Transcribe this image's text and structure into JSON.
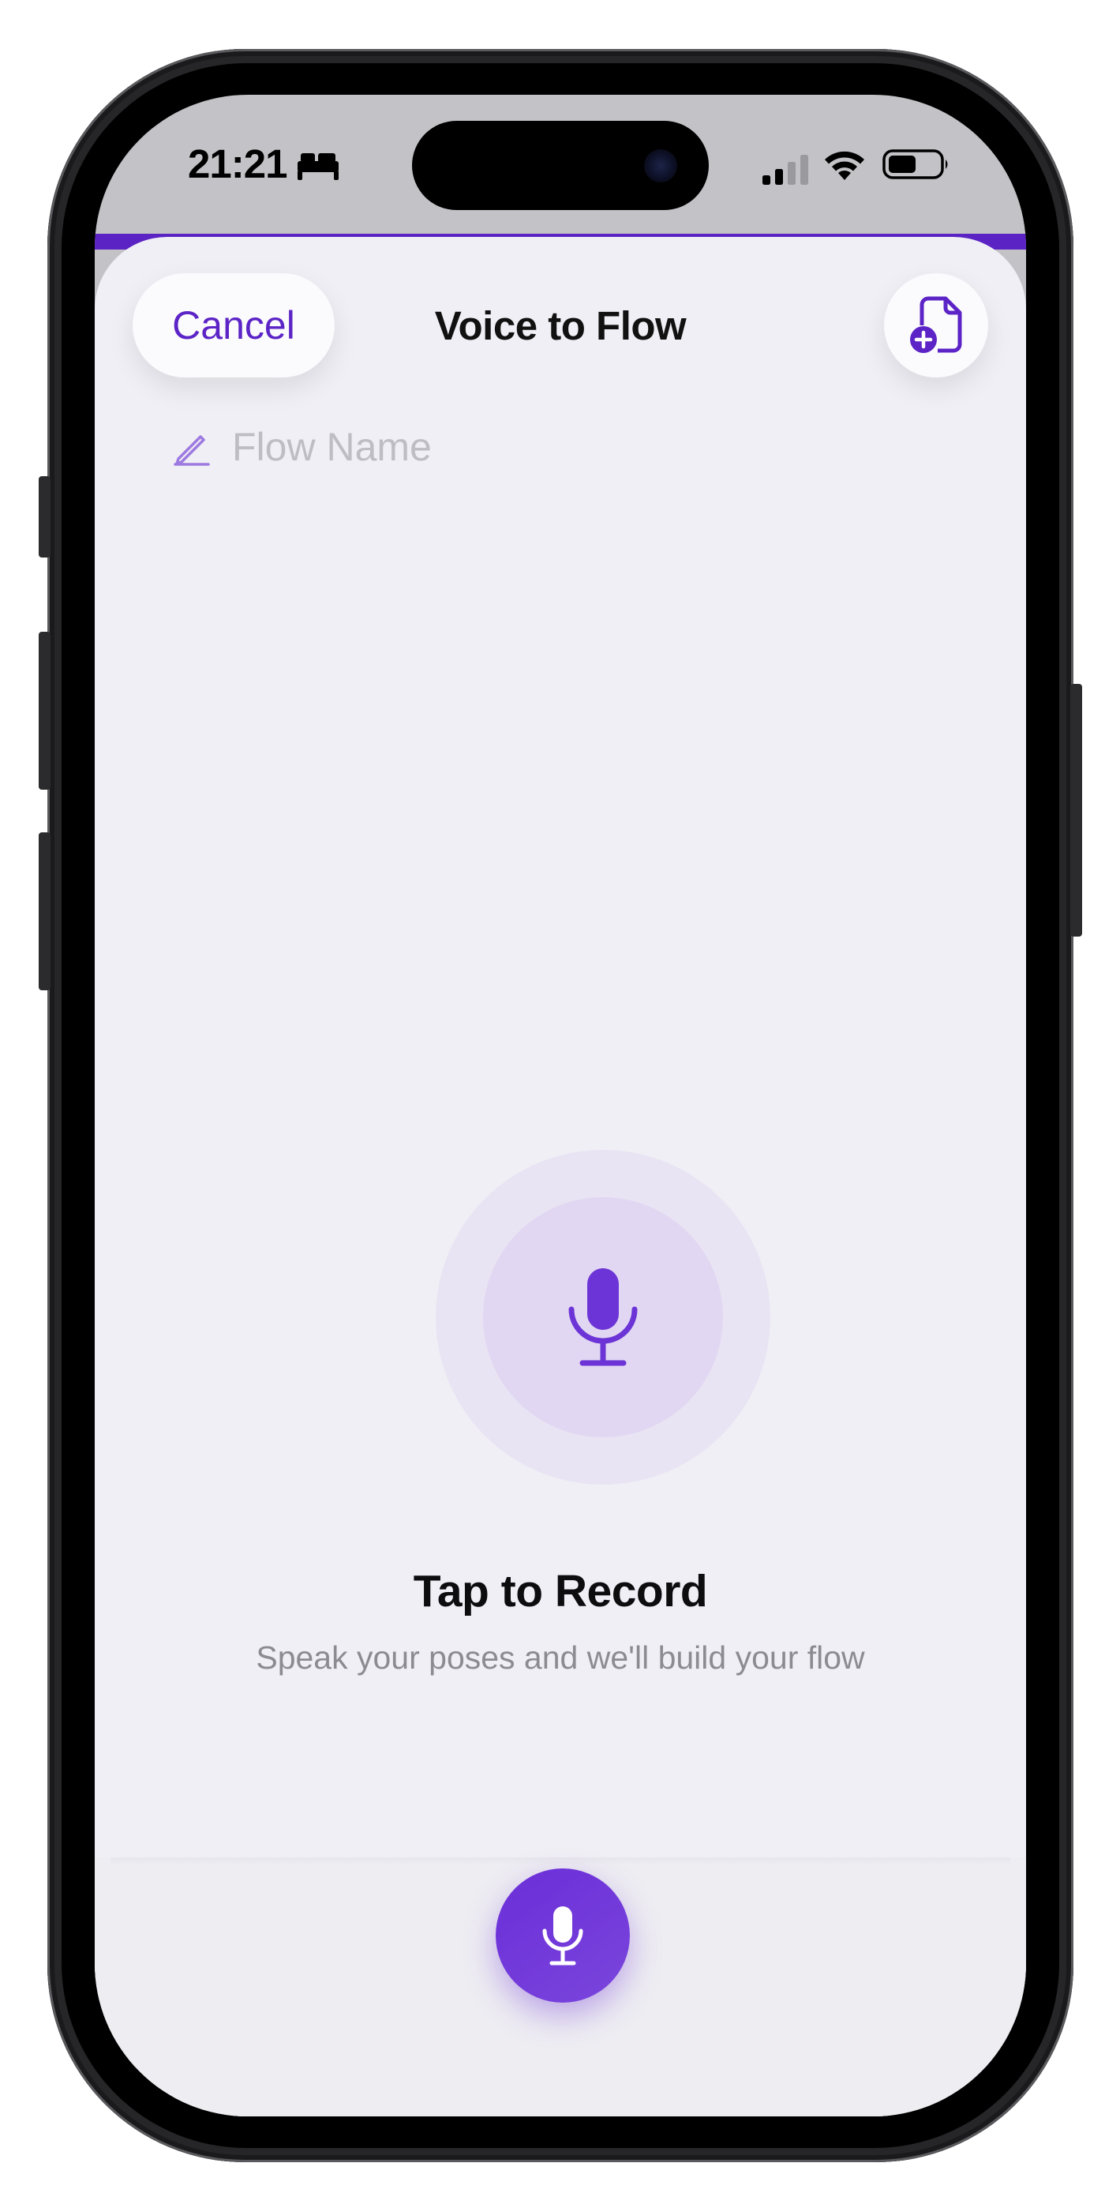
{
  "status_bar": {
    "time": "21:21",
    "focus_icon": "bed-icon",
    "signal_icon": "cellular-signal-icon",
    "wifi_icon": "wifi-icon",
    "battery_icon": "battery-icon",
    "battery_level": 0.55
  },
  "header": {
    "cancel_label": "Cancel",
    "title": "Voice to Flow",
    "action_icon": "add-document-icon"
  },
  "flow_name": {
    "icon": "pencil-icon",
    "placeholder": "Flow Name",
    "value": ""
  },
  "record": {
    "icon": "microphone-icon",
    "title": "Tap to Record",
    "subtitle": "Speak your poses and we'll build your flow"
  },
  "bottom_bar": {
    "record_button_icon": "microphone-icon"
  },
  "colors": {
    "accent": "#5c24c6",
    "sheet_background": "#f0eff5",
    "mic_ring_outer": "#e9e4f3",
    "mic_ring_inner": "#e1d7f2",
    "placeholder_text": "#bebdc3",
    "subtitle_text": "#8c8b91"
  }
}
